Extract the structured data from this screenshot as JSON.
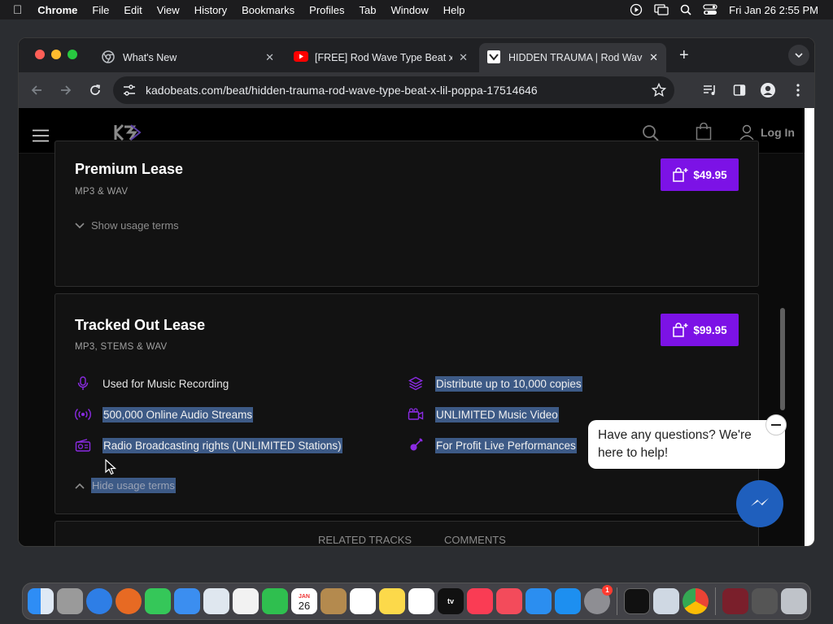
{
  "menubar": {
    "app": "Chrome",
    "items": [
      "File",
      "Edit",
      "View",
      "History",
      "Bookmarks",
      "Profiles",
      "Tab",
      "Window",
      "Help"
    ],
    "clock": "Fri Jan 26  2:55 PM"
  },
  "browser": {
    "tabs": [
      {
        "title": "What's New",
        "icon": "chrome-icon"
      },
      {
        "title": "[FREE] Rod Wave Type Beat x",
        "icon": "youtube-icon"
      },
      {
        "title": "HIDDEN TRAUMA | Rod Wave",
        "icon": "kado-icon"
      }
    ],
    "url": "kadobeats.com/beat/hidden-trauma-rod-wave-type-beat-x-lil-poppa-17514646"
  },
  "site": {
    "login": "Log In"
  },
  "licenses": [
    {
      "title": "Premium Lease",
      "formats": "MP3 & WAV",
      "price": "$49.95",
      "toggle": "Show usage terms"
    },
    {
      "title": "Tracked Out Lease",
      "formats": "MP3, STEMS & WAV",
      "price": "$99.95",
      "toggle": "Hide usage terms",
      "terms": [
        {
          "text": "Used for Music Recording",
          "icon": "microphone-icon"
        },
        {
          "text": "Distribute up to 10,000 copies",
          "icon": "layers-icon"
        },
        {
          "text": "500,000 Online Audio Streams",
          "icon": "broadcast-icon"
        },
        {
          "text": "UNLIMITED Music Video",
          "icon": "video-camera-icon"
        },
        {
          "text": "Radio Broadcasting rights (UNLIMITED Stations)",
          "icon": "radio-icon"
        },
        {
          "text": "For Profit Live Performances",
          "icon": "guitar-icon"
        }
      ]
    }
  ],
  "chat": {
    "message": "Have any questions? We're here to help!"
  },
  "bottom_tabs": [
    "RELATED TRACKS",
    "COMMENTS"
  ],
  "dock": {
    "calendar_month": "JAN",
    "calendar_day": "26",
    "apple_tv": "tv",
    "badge": "1"
  },
  "colors": {
    "accent": "#7c12e6",
    "selection": "#3d5a86"
  }
}
